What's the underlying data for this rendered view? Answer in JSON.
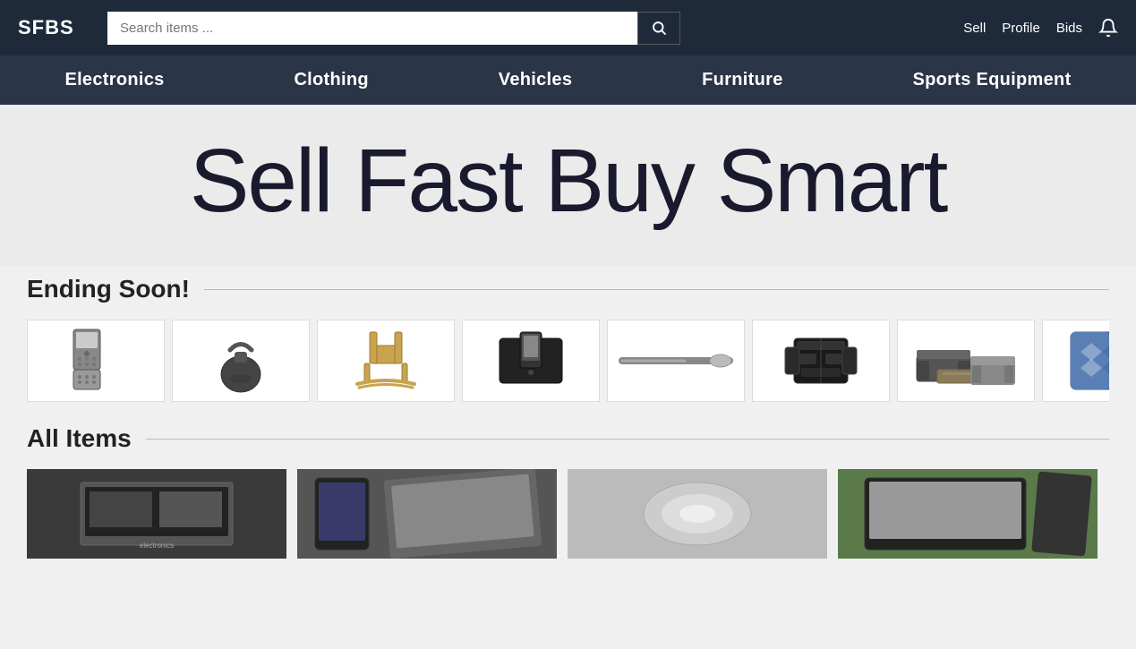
{
  "site": {
    "logo": "SFBS",
    "tagline": "Sell Fast Buy Smart"
  },
  "header": {
    "search_placeholder": "Search items ...",
    "nav_links": [
      {
        "label": "Sell",
        "name": "sell-link"
      },
      {
        "label": "Profile",
        "name": "profile-link"
      },
      {
        "label": "Bids",
        "name": "bids-link"
      }
    ]
  },
  "categories": [
    {
      "label": "Electronics",
      "name": "electronics"
    },
    {
      "label": "Clothing",
      "name": "clothing"
    },
    {
      "label": "Vehicles",
      "name": "vehicles"
    },
    {
      "label": "Furniture",
      "name": "furniture"
    },
    {
      "label": "Sports Equipment",
      "name": "sports-equipment"
    }
  ],
  "sections": {
    "ending_soon": {
      "title": "Ending Soon!",
      "items": [
        {
          "id": 1,
          "desc": "Motorola flip phone",
          "color": "#888"
        },
        {
          "id": 2,
          "desc": "Kettlebell",
          "color": "#555"
        },
        {
          "id": 3,
          "desc": "Wooden rocking chair",
          "color": "#c8a96e"
        },
        {
          "id": 4,
          "desc": "Phone dock/speaker",
          "color": "#333"
        },
        {
          "id": 5,
          "desc": "Baseball bat",
          "color": "#d4a96e"
        },
        {
          "id": 6,
          "desc": "Hockey chest protector",
          "color": "#2a2a2a"
        },
        {
          "id": 7,
          "desc": "Coffee table with sofa",
          "color": "#7a6a5a"
        },
        {
          "id": 8,
          "desc": "Blue decorative pillow",
          "color": "#4a6fa5"
        }
      ]
    },
    "all_items": {
      "title": "All Items",
      "items": [
        {
          "id": 1,
          "desc": "Electronics box",
          "color": "#555"
        },
        {
          "id": 2,
          "desc": "Tablet/phone",
          "color": "#666"
        },
        {
          "id": 3,
          "desc": "Misc item",
          "color": "#aaa"
        },
        {
          "id": 4,
          "desc": "Tablet on surface",
          "color": "#888"
        }
      ]
    }
  }
}
